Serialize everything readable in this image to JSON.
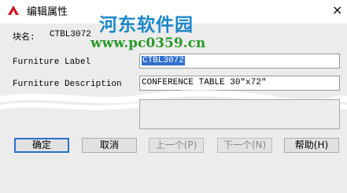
{
  "window": {
    "title": "编辑属性",
    "close_glyph": "×"
  },
  "watermark": {
    "logo_text": "河东软件园",
    "url_text": "www.pc0359.cn"
  },
  "block": {
    "label": "块名:",
    "value": "CTBL3072"
  },
  "fields": [
    {
      "label": "Furniture Label",
      "value": "CTBL3072",
      "selected": true
    },
    {
      "label": "Furniture Description",
      "value": "CONFERENCE TABLE 30\"x72\""
    }
  ],
  "buttons": {
    "ok": "确定",
    "cancel": "取消",
    "prev": "上一个(P)",
    "next": "下一个(N)",
    "help": "帮助(H)"
  },
  "colors": {
    "accent": "#2a6fcf",
    "selection": "#2f6fcf",
    "watermark_blue": "#1b87c8",
    "watermark_green": "#2a9a2a"
  },
  "icons": {
    "app": "autocad-a-icon",
    "close": "close-icon"
  }
}
